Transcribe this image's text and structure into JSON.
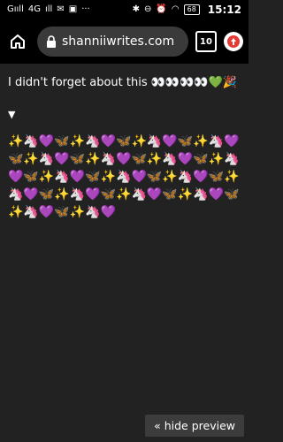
{
  "status": {
    "signal": "Gııll",
    "network": "4G",
    "signal2": "ıll",
    "battery": "68",
    "time": "15:12"
  },
  "toolbar": {
    "url": "shanniiwrites.com",
    "tab_count": "10"
  },
  "post": {
    "message": "I didn't forget about this 👀👀👀👀💚🎉",
    "toggle": "▼",
    "emoji_rows": "✨🦄💜🦋✨🦄💜🦋✨🦄💜🦋✨🦄💜🦋✨🦄💜🦋✨🦄💜🦋✨🦄💜🦋✨🦄💜🦋✨🦄💜🦋✨🦄💜🦋✨🦄💜🦋✨🦄💜🦋✨🦄💜🦋✨🦄💜🦋✨🦄💜🦋✨🦄💜🦋✨🦄💜"
  },
  "preview": {
    "hide_label": "« hide preview"
  },
  "colors": {
    "background": "#222222",
    "toolbar": "#000000",
    "url_pill": "#3a3a3a",
    "upload_icon": "#e53935"
  }
}
